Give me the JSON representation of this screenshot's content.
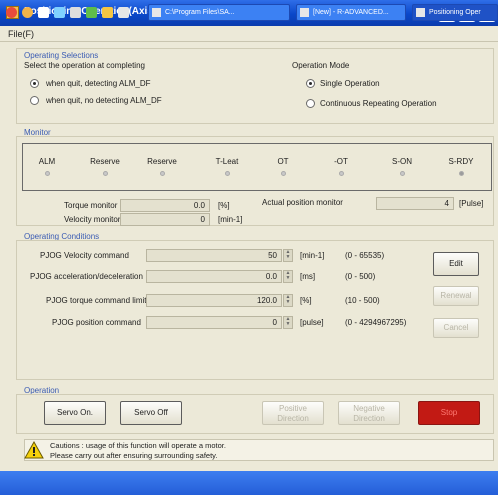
{
  "window": {
    "title": "Positioning Operation(Axis1)"
  },
  "title_buttons": [
    "_",
    "□",
    "X"
  ],
  "menu": {
    "file": "File(F)"
  },
  "operating_selections": {
    "title": "Operating Selections",
    "subtitle": "Select the operation at completing",
    "options": [
      "when quit, detecting ALM_DF",
      "when quit, no detecting ALM_DF"
    ],
    "selected_index": 0
  },
  "operation_mode": {
    "title": "Operation Mode",
    "options": [
      "Single Operation",
      "Continuous Repeating Operation"
    ],
    "selected_index": 0
  },
  "monitor": {
    "title": "Monitor",
    "signals": [
      "ALM",
      "Reserve",
      "Reserve",
      "T-Leat",
      "OT",
      "-OT",
      "S-ON",
      "S-RDY"
    ],
    "torque_label": "Torque monitor",
    "torque_value": "0.0",
    "torque_unit": "[%]",
    "velocity_label": "Velocity monitor",
    "velocity_value": "0",
    "velocity_unit": "[min-1]",
    "position_label": "Actual position monitor",
    "position_value": "4",
    "position_unit": "[Pulse]"
  },
  "operating_conditions": {
    "title": "Operating Conditions",
    "rows": [
      {
        "label": "PJOG Velocity command",
        "value": "50",
        "unit": "[min-1]",
        "range": "(0 - 65535)"
      },
      {
        "label": "PJOG acceleration/deceleration",
        "value": "0.0",
        "unit": "[ms]",
        "range": "(0 - 500)"
      },
      {
        "label": "PJOG torque command limit",
        "value": "120.0",
        "unit": "[%]",
        "range": "(10 - 500)"
      },
      {
        "label": "PJOG position command",
        "value": "0",
        "unit": "[pulse]",
        "range": "(0 - 4294967295)"
      }
    ],
    "edit_label": "Edit",
    "renewal_label": "Renewal",
    "cancel_label": "Cancel"
  },
  "operation": {
    "title": "Operation",
    "servo_on_label": "Servo On.",
    "servo_off_label": "Servo Off",
    "positive_label": "Positive Direction",
    "negative_label": "Negative Direction",
    "stop_label": "Stop"
  },
  "caution": {
    "line1": "Cautions : usage of this function will operate a motor.",
    "line2": "Please carry out after ensuring surrounding safety."
  },
  "taskbar": {
    "tasks": [
      "C:\\Program Files\\SA...",
      "[New] - R-ADVANCED...",
      "Positioning Oper"
    ]
  }
}
